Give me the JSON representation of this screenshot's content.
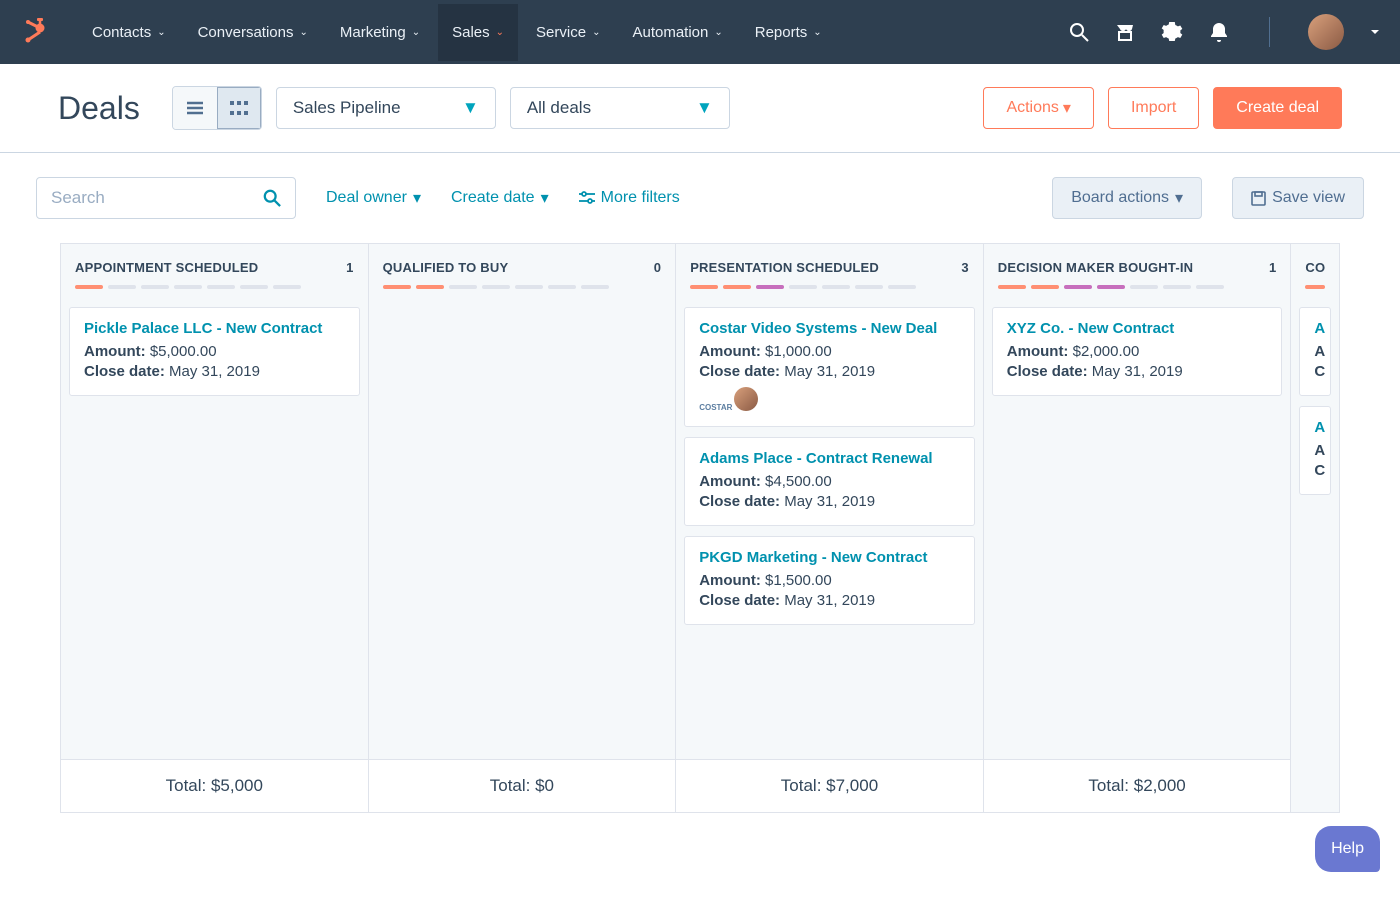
{
  "nav": {
    "items": [
      {
        "label": "Contacts"
      },
      {
        "label": "Conversations"
      },
      {
        "label": "Marketing"
      },
      {
        "label": "Sales"
      },
      {
        "label": "Service"
      },
      {
        "label": "Automation"
      },
      {
        "label": "Reports"
      }
    ]
  },
  "page": {
    "title": "Deals",
    "pipeline_select": "Sales Pipeline",
    "scope_select": "All deals",
    "actions_btn": "Actions",
    "import_btn": "Import",
    "create_btn": "Create deal"
  },
  "filters": {
    "search_placeholder": "Search",
    "deal_owner": "Deal owner",
    "create_date": "Create date",
    "more_filters": "More filters",
    "board_actions": "Board actions",
    "save_view": "Save view"
  },
  "labels": {
    "amount": "Amount:",
    "close_date": "Close date:",
    "total": "Total:"
  },
  "columns": [
    {
      "title": "APPOINTMENT SCHEDULED",
      "count": "1",
      "dashes": [
        "orange",
        "grey",
        "grey",
        "grey",
        "grey",
        "grey",
        "grey"
      ],
      "total": "$5,000",
      "cards": [
        {
          "title": "Pickle Palace LLC - New Contract",
          "amount": "$5,000.00",
          "close": "May 31, 2019",
          "avatar": false,
          "logo": false
        }
      ]
    },
    {
      "title": "QUALIFIED TO BUY",
      "count": "0",
      "dashes": [
        "orange",
        "orange",
        "grey",
        "grey",
        "grey",
        "grey",
        "grey"
      ],
      "total": "$0",
      "cards": []
    },
    {
      "title": "PRESENTATION SCHEDULED",
      "count": "3",
      "dashes": [
        "orange",
        "orange",
        "pink",
        "grey",
        "grey",
        "grey",
        "grey"
      ],
      "total": "$7,000",
      "cards": [
        {
          "title": "Costar Video Systems - New Deal",
          "amount": "$1,000.00",
          "close": "May 31, 2019",
          "avatar": true,
          "logo": true
        },
        {
          "title": "Adams Place - Contract Renewal",
          "amount": "$4,500.00",
          "close": "May 31, 2019",
          "avatar": false,
          "logo": false
        },
        {
          "title": "PKGD Marketing - New Contract",
          "amount": "$1,500.00",
          "close": "May 31, 2019",
          "avatar": false,
          "logo": false
        }
      ]
    },
    {
      "title": "DECISION MAKER BOUGHT-IN",
      "count": "1",
      "dashes": [
        "orange",
        "orange",
        "pink",
        "pink",
        "grey",
        "grey",
        "grey"
      ],
      "total": "$2,000",
      "cards": [
        {
          "title": "XYZ Co. - New Contract",
          "amount": "$2,000.00",
          "close": "May 31, 2019",
          "avatar": false,
          "logo": false
        }
      ]
    },
    {
      "title": "CO",
      "count": "",
      "dashes": [
        "orange"
      ],
      "total": "",
      "cards": [
        {
          "title": "A",
          "amount": "",
          "close": "",
          "prefix_a": "A",
          "prefix_c": "C"
        },
        {
          "title": "A",
          "amount": "",
          "close": "",
          "prefix_a": "A",
          "prefix_c": "C"
        }
      ],
      "cut": true
    }
  ],
  "help": "Help"
}
